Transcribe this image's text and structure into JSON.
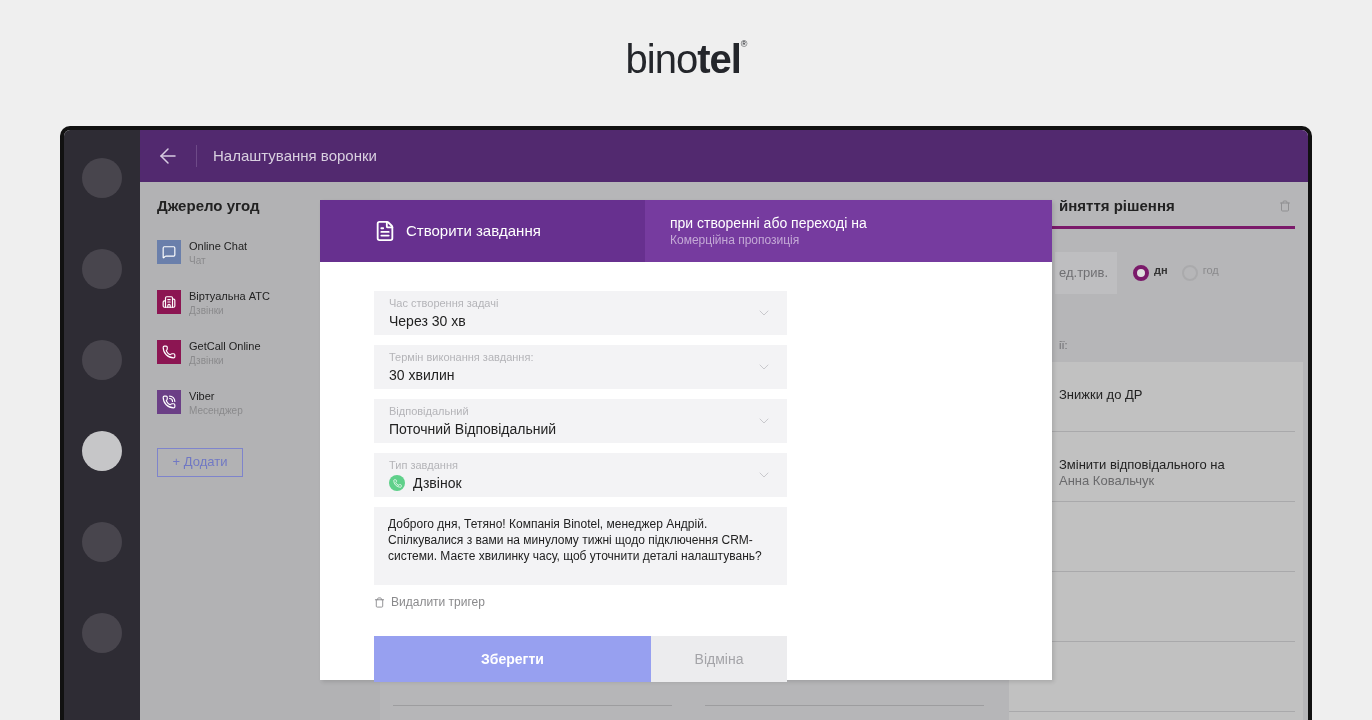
{
  "logo": "bino**tel**$^{®}$",
  "rail_items": [
    {
      "selected": false
    },
    {
      "selected": false
    },
    {
      "selected": false
    },
    {
      "selected": true
    },
    {
      "selected": false
    },
    {
      "selected": false
    }
  ],
  "header": {
    "title": "Налаштування воронки"
  },
  "sources": {
    "title": "Джерело угод",
    "items": [
      {
        "name": "Online Chat",
        "type": "Чат",
        "kind": "chat",
        "color": "#6a7fab"
      },
      {
        "name": "Віртуальна АТС",
        "type": "Дзвінки",
        "kind": "pbx",
        "color": "#8c1552"
      },
      {
        "name": "GetCall Online",
        "type": "Дзвінки",
        "kind": "phone",
        "color": "#8c1552"
      },
      {
        "name": "Viber",
        "type": "Месенджер",
        "kind": "viber",
        "color": "#6b3f86"
      }
    ],
    "add_button": "+ Додати"
  },
  "stage_column": {
    "title": "йняття рішення",
    "duration_placeholder": "ед.трив.",
    "units": [
      {
        "label": "дн",
        "selected": true
      },
      {
        "label": "год",
        "selected": false
      }
    ],
    "actions_label": "ії:",
    "actions": [
      {
        "title": "Знижки до ДР"
      },
      {
        "title": "Змінити відповідального на",
        "subtitle": "Анна Ковальчук"
      }
    ]
  },
  "modal": {
    "title": "Створити завдання",
    "trigger": {
      "text": "при створенні або переході на",
      "stage": "Комерційна пропозиція"
    },
    "fields": [
      {
        "label": "Час створення задачі",
        "value": "Через 30 хв",
        "kind": "select"
      },
      {
        "label": "Термін виконання завдання:",
        "value": "30 хвилин",
        "kind": "select"
      },
      {
        "label": "Відповідальний",
        "value": "Поточний Відповідальний",
        "kind": "select"
      },
      {
        "label": "Тип завдання",
        "value": "Дзвінок",
        "kind": "call"
      }
    ],
    "message": "Доброго дня, Тетяно! Компанія Binotel, менеджер Андрій. Спілкувалися з вами на минулому тижні щодо підключення CRM-системи. Маєте хвилинку часу, щоб уточнити деталі налаштувань?",
    "delete_link": "Видалити тригер",
    "save_button": "Зберегти",
    "cancel_button": "Відміна"
  }
}
